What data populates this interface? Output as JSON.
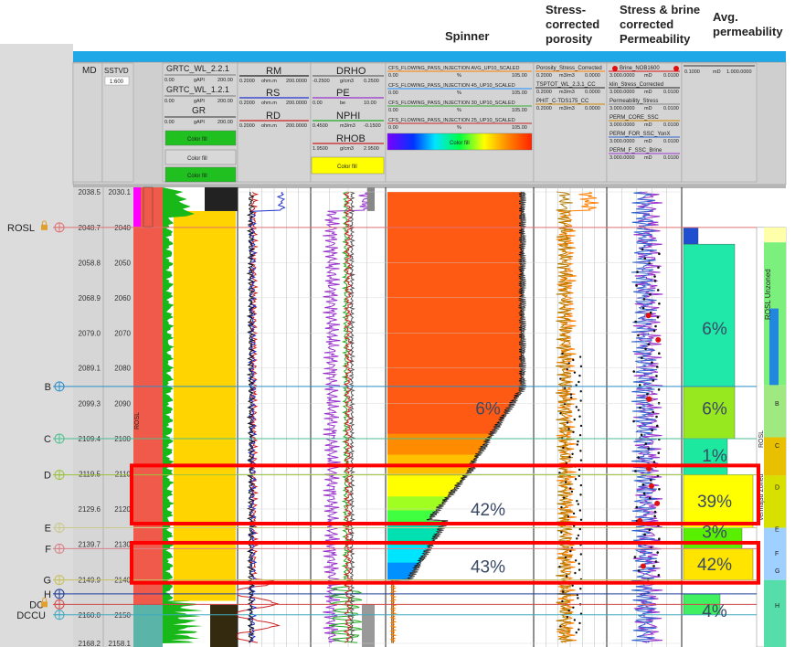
{
  "column_headers": {
    "spinner": "Spinner",
    "porosity": "Stress-\ncorrected\nporosity",
    "permeability": "Stress & brine\ncorrected\nPermeability",
    "avg_perm": "Avg.\npermeability"
  },
  "track_headers": {
    "md": "MD",
    "sstvd": "SSTVD",
    "sstvd_val": "1:600",
    "grtc2": "GRTC_WL_2.2.1",
    "grtc1": "GRTC_WL_1.2.1",
    "gr": "GR",
    "gr_scale": [
      "0.00",
      "gAPI",
      "200.00"
    ],
    "color_fill": "Color fill",
    "rm": "RM",
    "rs": "RS",
    "rd": "RD",
    "res_scale": [
      "0.2000",
      "ohm.m",
      "200.0000"
    ],
    "drho": "DRHO",
    "drho_scale": [
      "-0.2500",
      "g/cm3",
      "0.2500"
    ],
    "pe": "PE",
    "pe_scale": [
      "0.00",
      "be",
      "10.00"
    ],
    "nphi": "NPHI",
    "nphi_scale": [
      "0.4500",
      "m3/m3",
      "-0.1500"
    ],
    "rhob": "RHOB",
    "rhob_scale": [
      "1.9500",
      "g/cm3",
      "2.9500"
    ],
    "spinner_curves": [
      "CFS_FLOWING_PASS_INJECTION AVG_UP10_SCALED",
      "CFS_FLOWING_PASS_INJECTION 45_UP10_SCALED",
      "CFS_FLOWING_PASS_INJECTION 30_UP10_SCALED",
      "CFS_FLOWING_PASS_INJECTION 25_UP10_SCALED"
    ],
    "spinner_scale": [
      "0.00",
      "%",
      "105.00"
    ],
    "por_curves": [
      "Porosity_Stress_Corrected",
      "TSPTOT_WL_2.3.1_CC",
      "PHIT_C-TDS175_CC"
    ],
    "por_scale": [
      "0.2000",
      "m3/m3",
      "0.0000"
    ],
    "perm_curves": [
      "Brine_NOB1600",
      "klin_Stress_Corrected",
      "Permeability_Stress",
      "PERM_CORE_SSC",
      "PERM_FOR_SSC_YonX",
      "PERM_F_SSC_Brine"
    ],
    "perm_scale": [
      "3.000.0000",
      "mD",
      "0.0100"
    ],
    "avg_scale": [
      "0.1000",
      "mD",
      "1.000.0000"
    ]
  },
  "chart_data": {
    "type": "well_log",
    "depth_axis": {
      "md_ticks": [
        2038.5,
        2048.7,
        2058.8,
        2068.9,
        2079.0,
        2089.1,
        2099.3,
        2109.4,
        2119.5,
        2129.6,
        2139.7,
        2149.9,
        2160.0,
        2168.2
      ],
      "sstvd_ticks": [
        2030.1,
        2040,
        2050,
        2060,
        2070,
        2080,
        2090,
        2100,
        2110,
        2120,
        2130,
        2140,
        2150,
        2158.1
      ]
    },
    "markers": [
      {
        "name": "ROSL",
        "md": 2048.7,
        "color": "#e07070"
      },
      {
        "name": "B",
        "md": 2094.4,
        "color": "#2b8fc8"
      },
      {
        "name": "C",
        "md": 2109.4,
        "color": "#4cbf8f"
      },
      {
        "name": "D",
        "md": 2119.8,
        "color": "#9ac23c"
      },
      {
        "name": "E",
        "md": 2135.0,
        "color": "#c9c98a"
      },
      {
        "name": "F",
        "md": 2141.0,
        "color": "#d9808a"
      },
      {
        "name": "G",
        "md": 2150.0,
        "color": "#c8c060"
      },
      {
        "name": "H",
        "md": 2154.0,
        "color": "#1f3d9a"
      },
      {
        "name": "DC",
        "md": 2157.0,
        "color": "#d04b4b"
      },
      {
        "name": "DCCU",
        "md": 2160.0,
        "color": "#3fa9c0"
      }
    ],
    "spinner_labels": [
      {
        "text": "6%",
        "md": 2100.6
      },
      {
        "text": "42%",
        "md": 2129.6
      },
      {
        "text": "43%",
        "md": 2146.0
      }
    ],
    "avg_perm_labels": [
      {
        "text": "6%",
        "md": 2077.6
      },
      {
        "text": "6%",
        "md": 2100.6
      },
      {
        "text": "1%",
        "md": 2114.1
      },
      {
        "text": "39%",
        "md": 2127.3
      },
      {
        "text": "3%",
        "md": 2136.0
      },
      {
        "text": "42%",
        "md": 2145.3
      },
      {
        "text": "4%",
        "md": 2158.8
      }
    ],
    "highlight_zones": [
      [
        2117.1,
        2133.8
      ],
      [
        2139.3,
        2150.8
      ]
    ],
    "zone_labels": [
      "ROSL",
      "ROSL Unzoned",
      "ROSL",
      "Vermaj3d Zoned",
      "B",
      "C",
      "D",
      "E",
      "F",
      "G",
      "H"
    ]
  }
}
